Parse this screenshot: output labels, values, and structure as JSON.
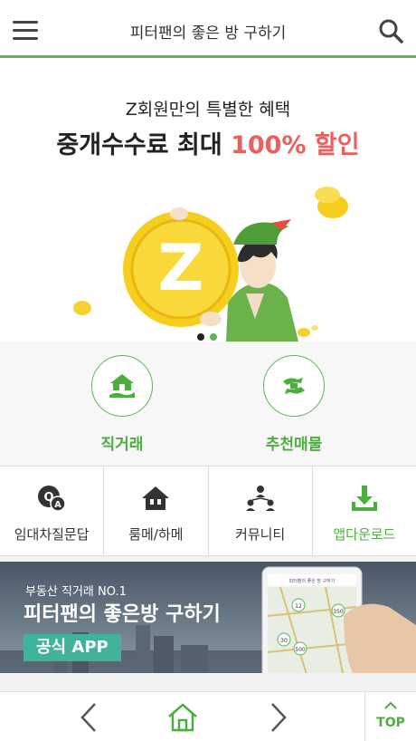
{
  "header": {
    "title": "피터팬의 좋은 방 구하기",
    "menu_icon": "hamburger-icon",
    "search_icon": "search-icon"
  },
  "promo": {
    "subtitle": "Z회원만의 특별한 혜택",
    "headline_prefix": "중개수수료 최대 ",
    "headline_highlight": "100% 할인",
    "coin_letter": "Z",
    "slides": {
      "count": 2,
      "active": 1
    }
  },
  "quick_menu": [
    {
      "label": "직거래",
      "icon": "house-hand-icon"
    },
    {
      "label": "추천매물",
      "icon": "hand-exchange-icon"
    }
  ],
  "sub_menu": [
    {
      "label": "임대차질문답",
      "icon": "qa-icon"
    },
    {
      "label": "룸메/하메",
      "icon": "house-icon"
    },
    {
      "label": "커뮤니티",
      "icon": "community-icon"
    },
    {
      "label": "앱다운로드",
      "icon": "download-icon"
    }
  ],
  "app_banner": {
    "subtitle": "부동산 직거래 NO.1",
    "title": "피터팬의 좋은방 구하기",
    "tag": "공식 APP",
    "phone_title": "피터팬의 좋은 방 구하기",
    "map_markers": [
      "12",
      "350",
      "30",
      "500"
    ]
  },
  "bottom_nav": {
    "top_label": "TOP"
  },
  "colors": {
    "brand_green": "#5ab552",
    "highlight_red": "#ec5f5f",
    "coin_yellow": "#f6cf1e",
    "app_tag": "#40b39a"
  }
}
